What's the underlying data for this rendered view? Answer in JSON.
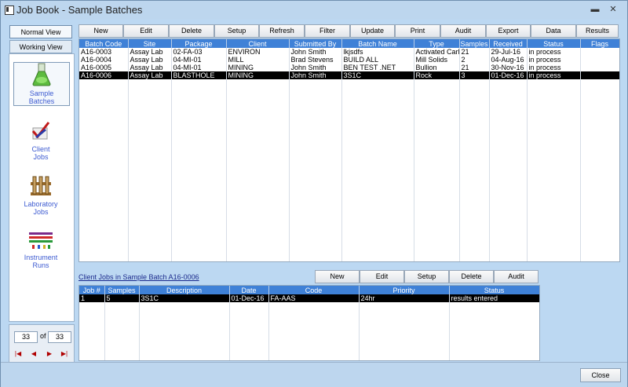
{
  "window": {
    "title": "Job Book - Sample Batches",
    "minimize_glyph": "▬",
    "close_glyph": "✕"
  },
  "left": {
    "normal_view": "Normal View",
    "working_view": "Working View",
    "nav": [
      {
        "label1": "Sample",
        "label2": "Batches",
        "icon": "flask-icon"
      },
      {
        "label1": "Client",
        "label2": "Jobs",
        "icon": "checkmark-pencil-icon"
      },
      {
        "label1": "Laboratory",
        "label2": "Jobs",
        "icon": "lab-rack-icon"
      },
      {
        "label1": "Instrument",
        "label2": "Runs",
        "icon": "spectrum-icon"
      }
    ],
    "pager": {
      "current": "33",
      "of_label": "of",
      "total": "33"
    }
  },
  "toolbar": {
    "buttons": [
      "New",
      "Edit",
      "Delete",
      "Setup",
      "Refresh",
      "Filter",
      "Update",
      "Print",
      "Audit",
      "Export",
      "Data",
      "Results"
    ]
  },
  "batches": {
    "columns": [
      "Batch Code",
      "Site",
      "Package",
      "Client",
      "Submitted By",
      "Batch Name",
      "Type",
      "Samples",
      "Received",
      "Status",
      "Flags"
    ],
    "rows": [
      [
        "A16-0003",
        "Assay Lab",
        "02-FA-03",
        "ENVIRON",
        "John Smith",
        "lkjsdfs",
        "Activated Carl",
        "21",
        "29-Jul-16",
        "in process",
        ""
      ],
      [
        "A16-0004",
        "Assay Lab",
        "04-MI-01",
        "MILL",
        "Brad Stevens",
        "BUILD ALL",
        "Mill Solids",
        "2",
        "04-Aug-16",
        "in process",
        ""
      ],
      [
        "A16-0005",
        "Assay Lab",
        "04-MI-01",
        "MINING",
        "John Smith",
        "BEN TEST .NET",
        "Bullion",
        "21",
        "30-Nov-16",
        "in process",
        ""
      ],
      [
        "A16-0006",
        "Assay Lab",
        "BLASTHOLE",
        "MINING",
        "John Smith",
        "3S1C",
        "Rock",
        "3",
        "01-Dec-16",
        "in process",
        ""
      ]
    ],
    "selected_row": 3
  },
  "client_jobs": {
    "title": "Client Jobs in Sample Batch A16-0006",
    "buttons": [
      "New",
      "Edit",
      "Setup",
      "Delete",
      "Audit"
    ],
    "columns": [
      "Job #",
      "Samples",
      "Description",
      "Date",
      "Code",
      "Priority",
      "Status"
    ],
    "rows": [
      [
        "1",
        "5",
        "3S1C",
        "01-Dec-16",
        "FA-AAS",
        "24hr",
        "results entered"
      ]
    ],
    "selected_row": 0
  },
  "footer": {
    "close_label": "Close"
  },
  "colors": {
    "header_blue": "#3f81d7",
    "selection": "#000000",
    "background": "#bcd8f2",
    "nav_text": "#3d5bd1"
  }
}
